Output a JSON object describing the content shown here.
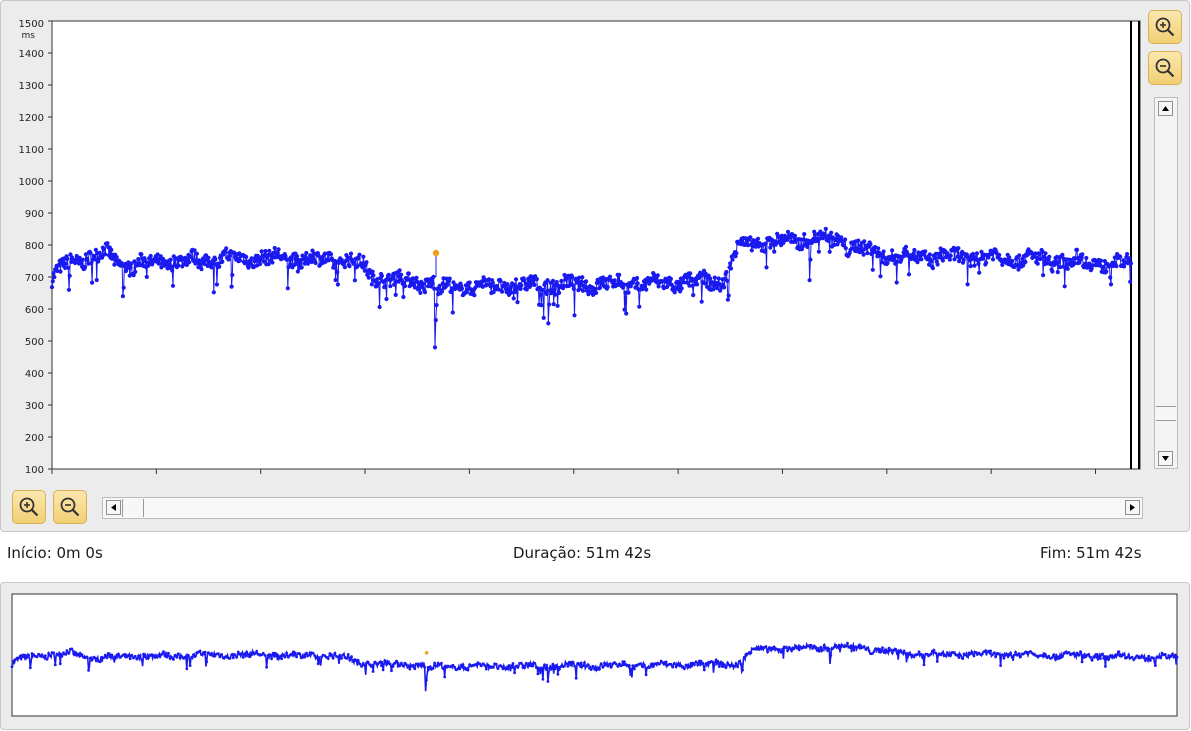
{
  "chart_data": {
    "type": "scatter",
    "x_unit": "min",
    "y_unit": "ms",
    "ylim": [
      100,
      1500
    ],
    "xlim": [
      0,
      51.7
    ],
    "y_ticks": [
      "100",
      "200",
      "300",
      "400",
      "500",
      "600",
      "700",
      "800",
      "900",
      "1000",
      "1100",
      "1200",
      "1300",
      "1400",
      "1500"
    ],
    "x_ticks": [
      "0",
      "5",
      "10",
      "15",
      "20",
      "25",
      "30",
      "35",
      "40",
      "45",
      "50min"
    ],
    "series_color": "#1a1af0",
    "highlight_color": "#f0a020",
    "segments": [
      {
        "x0": 0.0,
        "x1": 0.6,
        "y0": 690,
        "y1": 740
      },
      {
        "x0": 0.6,
        "x1": 2.5,
        "y0": 740,
        "y1": 775
      },
      {
        "x0": 2.5,
        "x1": 3.5,
        "y0": 775,
        "y1": 735
      },
      {
        "x0": 3.5,
        "x1": 6.0,
        "y0": 735,
        "y1": 750
      },
      {
        "x0": 6.0,
        "x1": 10.0,
        "y0": 750,
        "y1": 760
      },
      {
        "x0": 10.0,
        "x1": 14.5,
        "y0": 760,
        "y1": 750
      },
      {
        "x0": 14.5,
        "x1": 15.5,
        "y0": 750,
        "y1": 700
      },
      {
        "x0": 15.5,
        "x1": 18.3,
        "y0": 700,
        "y1": 680
      },
      {
        "x0": 18.3,
        "x1": 20.0,
        "y0": 665,
        "y1": 670
      },
      {
        "x0": 20.0,
        "x1": 29.0,
        "y0": 670,
        "y1": 680
      },
      {
        "x0": 29.0,
        "x1": 32.0,
        "y0": 680,
        "y1": 690
      },
      {
        "x0": 32.0,
        "x1": 32.8,
        "y0": 660,
        "y1": 780
      },
      {
        "x0": 32.8,
        "x1": 36.5,
        "y0": 800,
        "y1": 820
      },
      {
        "x0": 36.5,
        "x1": 38.0,
        "y0": 830,
        "y1": 810
      },
      {
        "x0": 38.0,
        "x1": 40.0,
        "y0": 800,
        "y1": 770
      },
      {
        "x0": 40.0,
        "x1": 46.0,
        "y0": 765,
        "y1": 760
      },
      {
        "x0": 46.0,
        "x1": 51.7,
        "y0": 760,
        "y1": 740
      }
    ],
    "dips": [
      {
        "x": 0.8,
        "y": 660
      },
      {
        "x": 3.4,
        "y": 640
      },
      {
        "x": 8.6,
        "y": 670
      },
      {
        "x": 18.35,
        "y": 480
      },
      {
        "x": 23.8,
        "y": 555
      },
      {
        "x": 36.3,
        "y": 690
      }
    ],
    "highlight_point": {
      "x": 18.4,
      "y": 775
    }
  },
  "info": {
    "start_label": "Início: 0m 0s",
    "duration_label": "Duração: 51m 42s",
    "end_label": "Fim: 51m 42s"
  },
  "icons": {
    "zoom_in": "zoom-in-icon",
    "zoom_out": "zoom-out-icon"
  }
}
